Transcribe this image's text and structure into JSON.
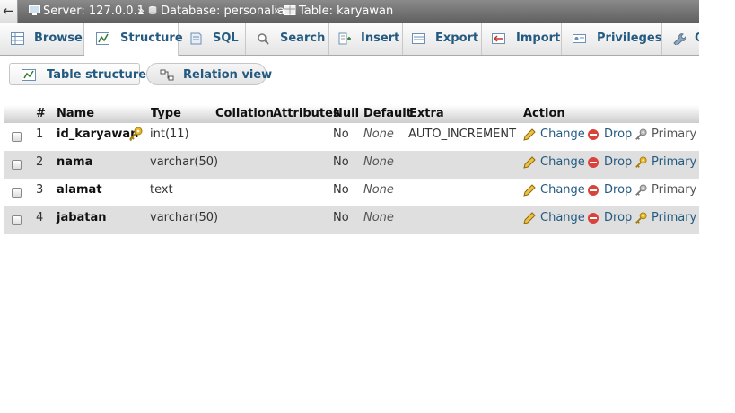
{
  "breadcrumb": {
    "back": "←",
    "server": "Server: 127.0.0.1",
    "database": "Database: personalia",
    "table": "Table: karyawan",
    "separator": "»"
  },
  "tabs": [
    {
      "label": "Browse",
      "icon": "browse-icon",
      "active": false
    },
    {
      "label": "Structure",
      "icon": "structure-icon",
      "active": true
    },
    {
      "label": "SQL",
      "icon": "sql-icon",
      "active": false
    },
    {
      "label": "Search",
      "icon": "search-icon",
      "active": false
    },
    {
      "label": "Insert",
      "icon": "insert-icon",
      "active": false
    },
    {
      "label": "Export",
      "icon": "export-icon",
      "active": false
    },
    {
      "label": "Import",
      "icon": "import-icon",
      "active": false
    },
    {
      "label": "Privileges",
      "icon": "privileges-icon",
      "active": false
    },
    {
      "label": "O",
      "icon": "wrench-icon",
      "active": false
    }
  ],
  "subnav": {
    "table_structure": "Table structure",
    "relation_view": "Relation view"
  },
  "table": {
    "headers": {
      "num": "#",
      "name": "Name",
      "type": "Type",
      "collation": "Collation",
      "attributes": "Attributes",
      "null": "Null",
      "default": "Default",
      "extra": "Extra",
      "action": "Action"
    },
    "rows": [
      {
        "num": "1",
        "name": "id_karyawan",
        "type": "int(11)",
        "null": "No",
        "default": "None",
        "extra": "AUTO_INCREMENT",
        "primary_key": true,
        "actions": {
          "change": "Change",
          "drop": "Drop",
          "primary": "Primary"
        }
      },
      {
        "num": "2",
        "name": "nama",
        "type": "varchar(50)",
        "null": "No",
        "default": "None",
        "extra": "",
        "primary_key": false,
        "actions": {
          "change": "Change",
          "drop": "Drop",
          "primary": "Primary"
        }
      },
      {
        "num": "3",
        "name": "alamat",
        "type": "text",
        "null": "No",
        "default": "None",
        "extra": "",
        "primary_key": false,
        "actions": {
          "change": "Change",
          "drop": "Drop",
          "primary": "Primary"
        }
      },
      {
        "num": "4",
        "name": "jabatan",
        "type": "varchar(50)",
        "null": "No",
        "default": "None",
        "extra": "",
        "primary_key": false,
        "actions": {
          "change": "Change",
          "drop": "Drop",
          "primary": "Primary"
        }
      }
    ]
  },
  "colors": {
    "link": "#235a81",
    "row_alt": "#dfdfdf",
    "crumb_bar": "#6e6e6e",
    "drop_red": "#d9433b",
    "key_gold": "#e8b923"
  }
}
